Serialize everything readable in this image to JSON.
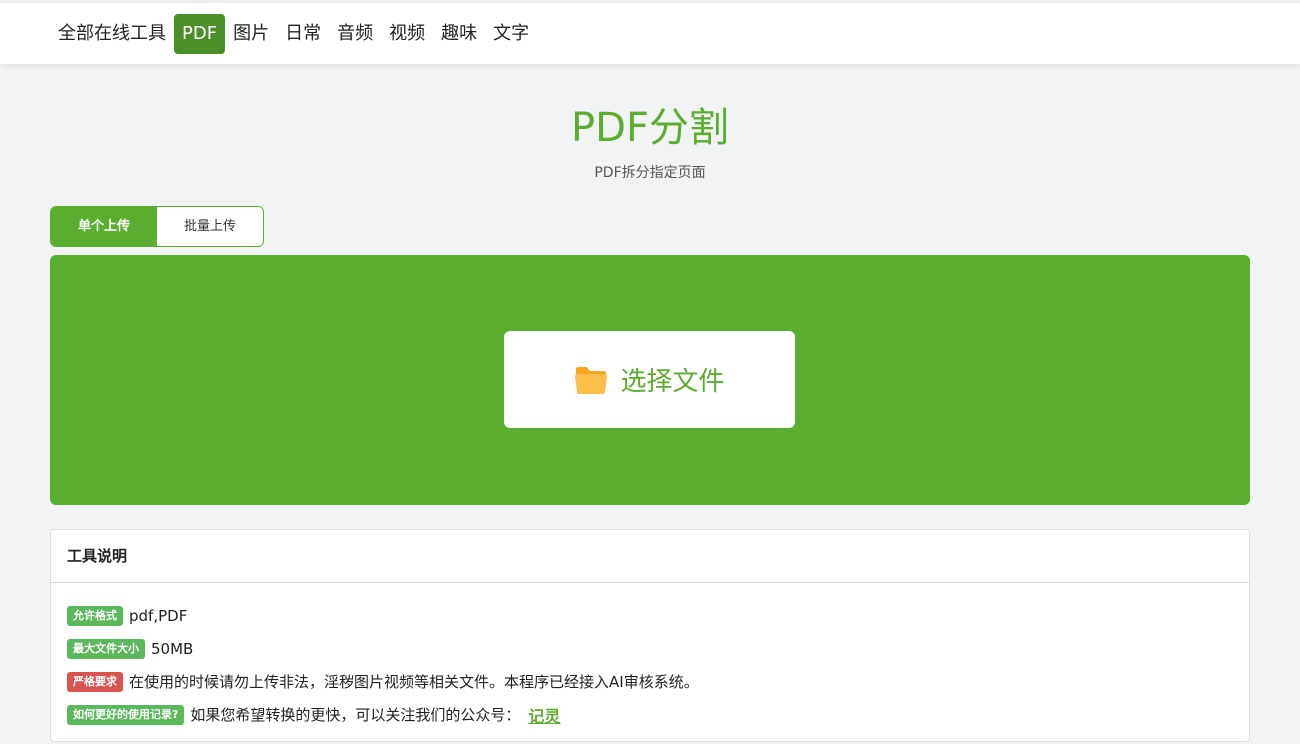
{
  "nav": {
    "items": [
      {
        "label": "全部在线工具",
        "active": false
      },
      {
        "label": "PDF",
        "active": true
      },
      {
        "label": "图片",
        "active": false
      },
      {
        "label": "日常",
        "active": false
      },
      {
        "label": "音频",
        "active": false
      },
      {
        "label": "视频",
        "active": false
      },
      {
        "label": "趣味",
        "active": false
      },
      {
        "label": "文字",
        "active": false
      }
    ]
  },
  "header": {
    "title": "PDF分割",
    "subtitle": "PDF拆分指定页面"
  },
  "tabs": {
    "single": "单个上传",
    "batch": "批量上传"
  },
  "upload": {
    "button_label": "选择文件",
    "icon": "folder-icon"
  },
  "info": {
    "title": "工具说明",
    "rows": [
      {
        "badge": "允许格式",
        "text": "pdf,PDF",
        "badge_color": "#5cb85c"
      },
      {
        "badge": "最大文件大小",
        "text": "50MB",
        "badge_color": "#5cb85c"
      },
      {
        "badge": "严格要求",
        "text": "在使用的时候请勿上传非法，淫秽图片视频等相关文件。本程序已经接入AI审核系统。",
        "badge_color": "#d9534f"
      },
      {
        "badge": "如何更好的使用记录?",
        "text": "如果您希望转换的更快，可以关注我们的公众号：",
        "badge_color": "#5cb85c",
        "link": "记灵"
      }
    ]
  },
  "colors": {
    "brand": "#5bad2f",
    "nav_active": "#4a8f29",
    "badge_green": "#5cb85c",
    "badge_red": "#d9534f"
  }
}
